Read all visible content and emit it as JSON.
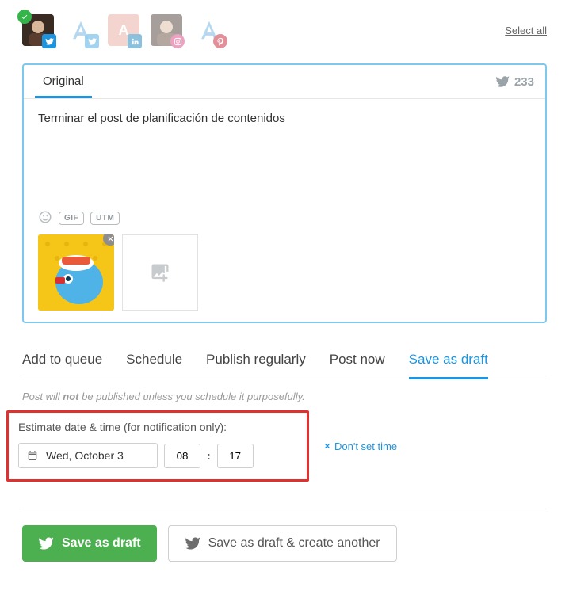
{
  "header": {
    "select_all": "Select all"
  },
  "composer": {
    "tab_original": "Original",
    "char_count": "233",
    "text": "Terminar el post de planificación de contenidos",
    "gif_label": "GIF",
    "utm_label": "UTM"
  },
  "publish_tabs": {
    "add_to_queue": "Add to queue",
    "schedule": "Schedule",
    "publish_regularly": "Publish regularly",
    "post_now": "Post now",
    "save_as_draft": "Save as draft"
  },
  "draft": {
    "hint_prefix": "Post will ",
    "hint_not": "not",
    "hint_suffix": " be published unless you schedule it purposefully.",
    "estimate_label": "Estimate date & time (for notification only):",
    "date": "Wed, October 3",
    "hour": "08",
    "minute": "17",
    "dont_set": "Don't set time"
  },
  "buttons": {
    "save_draft": "Save as draft",
    "save_another": "Save as draft & create another"
  }
}
